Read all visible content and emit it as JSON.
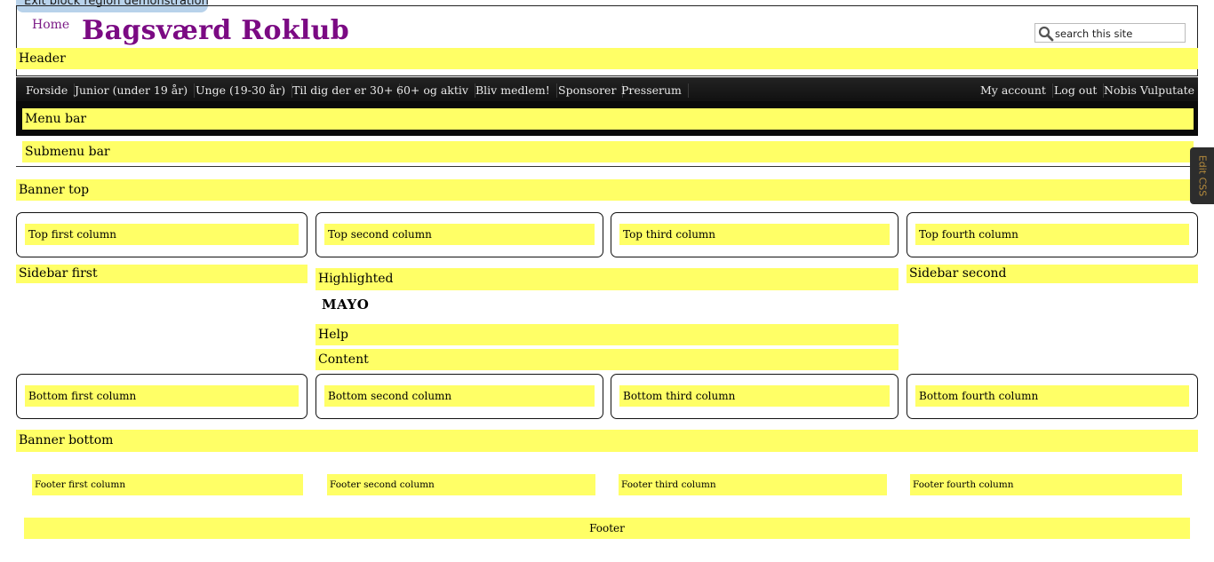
{
  "exit_block_demo": "Exit block region demonstration",
  "header": {
    "home_link": "Home",
    "site_name": "Bagsværd Roklub",
    "search_placeholder": "search this site",
    "region_label": "Header"
  },
  "nav": {
    "items": [
      "Forside",
      "Junior (under 19 år)",
      "Unge (19-30 år)",
      "Til dig der er 30+",
      "60+ og aktiv",
      "Bliv medlem!",
      "Sponsorer",
      "Presserum"
    ],
    "user_items": [
      "My account",
      "Log out",
      "Nobis Vulputate"
    ]
  },
  "regions": {
    "menu_bar": "Menu bar",
    "submenu_bar": "Submenu bar",
    "banner_top": "Banner top",
    "top_columns": [
      "Top first column",
      "Top second column",
      "Top third column",
      "Top fourth column"
    ],
    "sidebar_first": "Sidebar first",
    "highlighted": "Highlighted",
    "page_title": "MAYO",
    "help": "Help",
    "content": "Content",
    "sidebar_second": "Sidebar second",
    "bottom_columns": [
      "Bottom first column",
      "Bottom second column",
      "Bottom third column",
      "Bottom fourth column"
    ],
    "banner_bottom": "Banner bottom",
    "footer_columns": [
      "Footer first column",
      "Footer second column",
      "Footer third column",
      "Footer fourth column"
    ],
    "footer": "Footer"
  },
  "edit_css": "Edit CSS",
  "colors": {
    "region_fill": "#ffff66",
    "brand": "#7b0a83",
    "nav_bg": "#0a0a0a"
  }
}
